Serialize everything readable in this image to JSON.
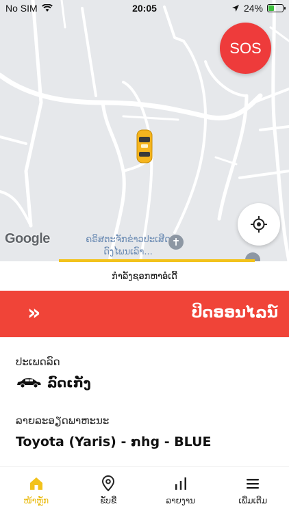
{
  "status_bar": {
    "carrier": "No SIM",
    "time": "20:05",
    "battery": "24%"
  },
  "map": {
    "sos_label": "SOS",
    "poi_label_line1": "ຄຣິສຕະຈັກຂ່າວປະເສີດ",
    "poi_label_line2": "ດົງໄພນເລົາ...",
    "google_label": "Google"
  },
  "status": {
    "searching_text": "ກໍາລັງຊອກຫາອໍເດີ້"
  },
  "offline_button": {
    "chevrons": "»",
    "label": "ປິດອອນໄລນ໌"
  },
  "vehicle": {
    "type_label": "ປະເພດລົດ",
    "type_value": "ລົດເກັງ",
    "details_label": "ລາຍລະອຽດພາຫະນະ",
    "details_value": "Toyota (Yaris) - ກhg - BLUE"
  },
  "tabs": [
    {
      "label": "ໜ້າຫຼັກ",
      "icon": "home-icon",
      "active": true
    },
    {
      "label": "ຂັບຂີ່",
      "icon": "map-pin-icon",
      "active": false
    },
    {
      "label": "ລາຍງານ",
      "icon": "bar-chart-icon",
      "active": false
    },
    {
      "label": "ເພີ່ມເຕີມ",
      "icon": "menu-icon",
      "active": false
    }
  ],
  "colors": {
    "accent_yellow": "#F2C21B",
    "offline_red": "#F04438",
    "sos_red": "#EE3B3B",
    "map_background": "#E6E8EB"
  }
}
